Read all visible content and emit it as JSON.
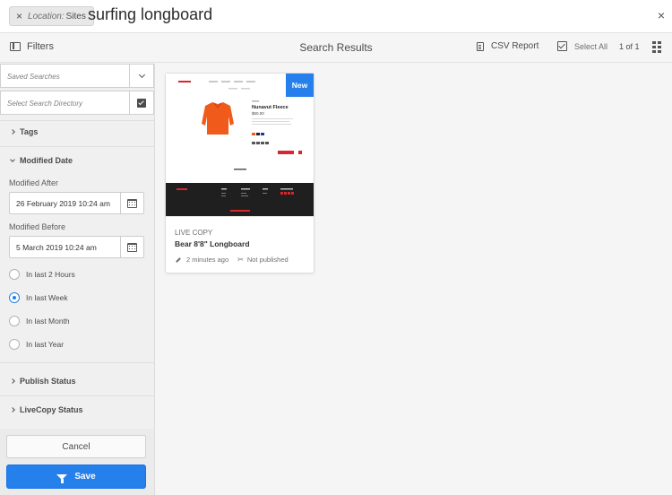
{
  "omnisearch": {
    "tag_key": "Location:",
    "tag_value": "Sites",
    "query": "surfing longboard",
    "close_glyph": "×",
    "tag_remove_glyph": "×"
  },
  "toolbar": {
    "filters_label": "Filters",
    "title": "Search Results",
    "csv_label": "CSV Report",
    "select_all_label": "Select All",
    "paging": "1 of 1"
  },
  "rail": {
    "saved_searches_placeholder": "Saved Searches",
    "directory_placeholder": "Select Search Directory",
    "sections": {
      "tags": "Tags",
      "modified_date": "Modified Date",
      "publish_status": "Publish Status",
      "livecopy_status": "LiveCopy Status"
    },
    "modified_after_label": "Modified After",
    "modified_after_value": "26 February 2019 10:24 am",
    "modified_before_label": "Modified Before",
    "modified_before_value": "5 March 2019 10:24 am",
    "radios": [
      {
        "label": "In last 2 Hours",
        "selected": false
      },
      {
        "label": "In last Week",
        "selected": true
      },
      {
        "label": "In last Month",
        "selected": false
      },
      {
        "label": "In last Year",
        "selected": false
      }
    ],
    "cancel_label": "Cancel",
    "save_label": "Save"
  },
  "results": [
    {
      "badge": "New",
      "type": "LIVE COPY",
      "title": "Bear 8'8\" Longboard",
      "modified": "2 minutes ago",
      "publish_status": "Not published",
      "thumbnail": {
        "product_name": "Nunavut Fleece",
        "price": "$50.00"
      }
    }
  ],
  "colors": {
    "accent": "#2680eb",
    "product": "#f05a1a",
    "footer": "#1f1f1f",
    "cta": "#d7262c"
  }
}
